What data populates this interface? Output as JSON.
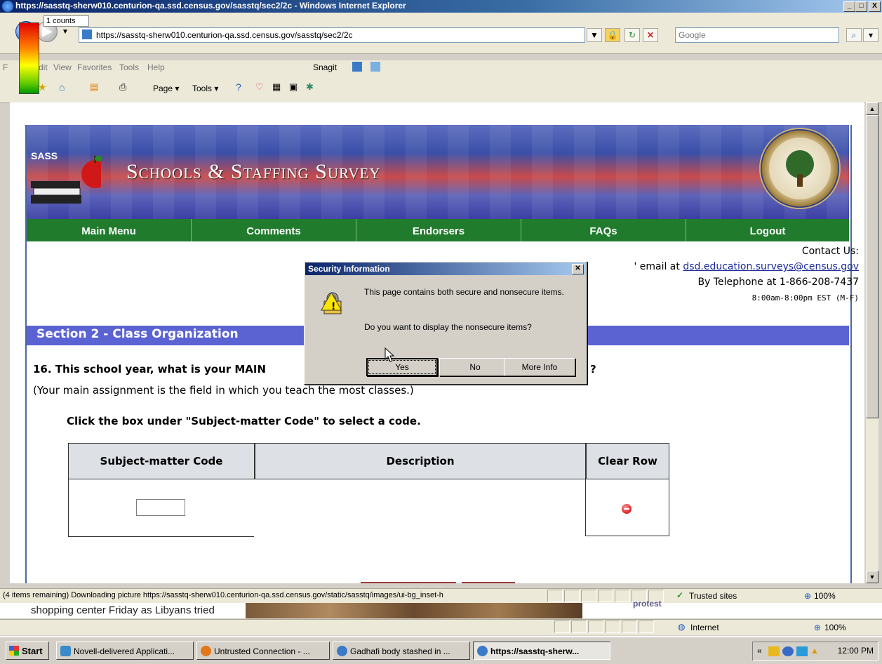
{
  "window": {
    "title": "https://sasstq-sherw010.centurion-qa.ssd.census.gov/sasstq/sec2/2c - Windows Internet Explorer",
    "minimize": "_",
    "maximize": "□",
    "close": "X"
  },
  "counts_gadget": {
    "label": "1 counts"
  },
  "addressbar": {
    "url": "https://sasstq-sherw010.centurion-qa.ssd.census.gov/sasstq/sec2/2c",
    "search_placeholder": "Google"
  },
  "menubar": {
    "items": [
      "F",
      "Edit",
      "View",
      "Favorites",
      "Tools",
      "Help"
    ],
    "snagit": "Snagit"
  },
  "cmdbar": {
    "page": "Page ▾",
    "tools": "Tools ▾"
  },
  "site": {
    "logo_text": "SASS",
    "title": "Schools & Staffing Survey",
    "nav": [
      "Main Menu",
      "Comments",
      "Endorsers",
      "FAQs",
      "Logout"
    ],
    "contact_title": "Contact Us:",
    "contact_email_prefix": "' email at ",
    "contact_email": "dsd.education.surveys@census.gov",
    "contact_phone": "By Telephone at 1-866-208-7437",
    "contact_hours": "8:00am-8:00pm EST (M-F)",
    "section_title": "Section 2 - Class Organization",
    "question": "16. This school year, what is your MAIN",
    "question_tail": "?",
    "question_note": "(Your main assignment is the field in which you teach the most classes.)",
    "instruction": "Click the box under \"Subject-matter Code\" to select a code.",
    "table": {
      "headers": [
        "Subject-matter Code",
        "Description",
        "Clear Row"
      ]
    }
  },
  "dialog": {
    "title": "Security Information",
    "message1": "This page contains both secure and nonsecure items.",
    "message2": "Do you want to display the nonsecure items?",
    "buttons": {
      "yes": "Yes",
      "no": "No",
      "more_info": "More Info"
    }
  },
  "status1": {
    "text": "(4 items remaining) Downloading picture https://sasstq-sherw010.centurion-qa.ssd.census.gov/static/sasstq/images/ui-bg_inset-h",
    "zone": "Trusted sites",
    "zoom": "100%"
  },
  "background_page": {
    "snippet": "shopping center Friday as Libyans tried",
    "side_text": "protest"
  },
  "status2": {
    "zone": "Internet",
    "zoom": "100%"
  },
  "taskbar": {
    "start": "Start",
    "tasks": [
      "Novell-delivered Applicati...",
      "Untrusted Connection - ...",
      "Gadhafi body stashed in ...",
      "https://sasstq-sherw..."
    ],
    "tray_chevron": "«",
    "clock": "12:00 PM"
  }
}
